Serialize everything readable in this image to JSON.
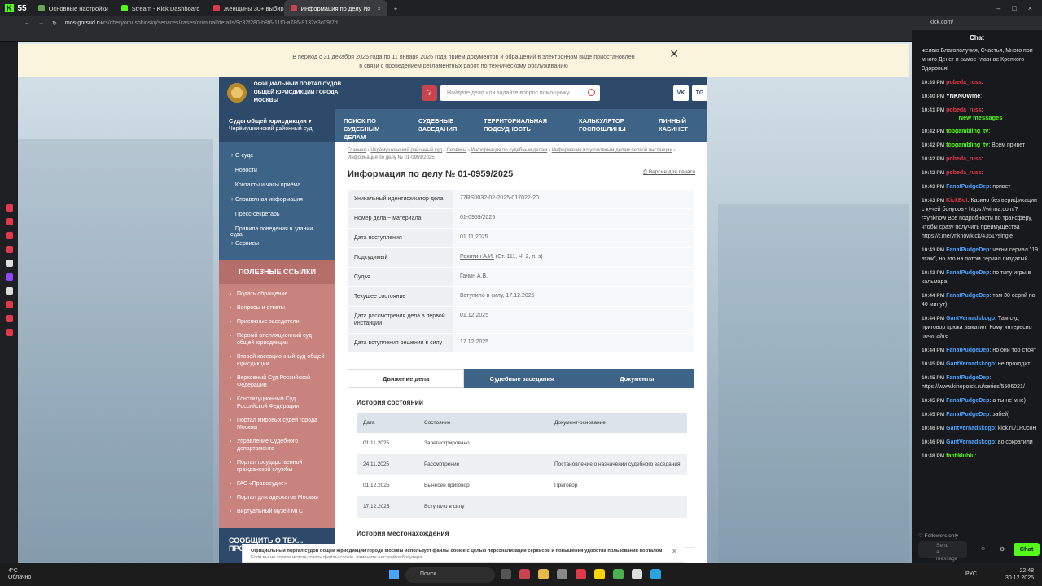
{
  "browser": {
    "kick_badge": "55",
    "tabs": [
      {
        "label": "Основные настройки",
        "color": "#6aa84f"
      },
      {
        "label": "Stream - Kick Dashboard",
        "color": "#53fc18"
      },
      {
        "label": "Женщины 30+ выбирают",
        "color": "#e0394a"
      },
      {
        "label": "Информация по делу №",
        "color": "#c9444c",
        "active": true
      }
    ],
    "url_host": "mos-gorsud.ru",
    "url_path": "/rs/cheryomushkinskij/services/cases/criminal/details/9c32f280-b8f6-11f0-a786-8132e3c09f7d",
    "right_url": "kick.com/"
  },
  "notice": {
    "line1": "В период с 31 декабря 2025 года по 11 января 2026 года приём документов и обращений в электронном виде приостановлен",
    "line2": "в связи с проведением регламентных работ по техническому обслуживанию"
  },
  "site": {
    "portal_title": "ОФИЦИАЛЬНЫЙ ПОРТАЛ СУДОВ ОБЩЕЙ ЮРИСДИКЦИИ ГОРОДА МОСКВЫ",
    "search_placeholder": "Найдите дело или задайте вопрос помощнику",
    "social": [
      "VK",
      "TG"
    ],
    "court_select": {
      "title": "Суды общей юрисдикции",
      "sub": "Черёмушкинский районный суд"
    },
    "nav": [
      "Поиск по судебным делам",
      "Судебные заседания",
      "Территориальная подсудность",
      "Калькулятор госпошлины",
      "Личный кабинет"
    ],
    "left_menu": [
      "О суде",
      "Новости",
      "Контакты и часы приёма",
      "Справочная информация",
      "Пресс-секретарь",
      "Правила поведения в здании суда",
      "Сервисы"
    ],
    "useful_title": "ПОЛЕЗНЫЕ ССЫЛКИ",
    "useful_links": [
      "Подать обращение",
      "Вопросы и ответы",
      "Присяжные заседатели",
      "Первый апелляционный суд общей юрисдикции",
      "Второй кассационный суд общей юрисдикции",
      "Верховный Суд Российской Федерации",
      "Конституционный Суд Российской Федерации",
      "Портал мировых судей города Москвы",
      "Управление Судебного департамента",
      "Портал государственной гражданской службы",
      "ГАС «Правосудие»",
      "Портал для адвокатов Москвы",
      "Виртуальный музей МГС"
    ],
    "report_box": "СООБЩИТЬ О ТЕХ... ПРО..."
  },
  "content": {
    "breadcrumb": [
      "Главная",
      "Черёмушкинский районный суд",
      "Сервисы",
      "Информация по судебным делам",
      "Информация по уголовным делам первой инстанции",
      "Информация по делу № 01-0959/2025"
    ],
    "title": "Информация по делу № 01-0959/2025",
    "print_link": "Версия для печати",
    "info": [
      {
        "k": "Уникальный идентификатор дела",
        "v": "77RS0032-02-2025-017022-20"
      },
      {
        "k": "Номер дела ~ материала",
        "v": "01-0959/2025"
      },
      {
        "k": "Дата поступления",
        "v": "01.11.2025"
      },
      {
        "k": "Подсудимый",
        "v": "Ракитин А.И.",
        "v2": " (Ст. 111, Ч. 2, п. з)"
      },
      {
        "k": "Судья",
        "v": "Ганин А.В."
      },
      {
        "k": "Текущее состояние",
        "v": "Вступило в силу, 17.12.2025"
      },
      {
        "k": "Дата рассмотрения дела в первой инстанции",
        "v": "01.12.2025"
      },
      {
        "k": "Дата вступления решения в силу",
        "v": "17.12.2025"
      }
    ],
    "tabs": [
      "Движение дела",
      "Судебные заседания",
      "Документы"
    ],
    "history_title": "История состояний",
    "history_headers": [
      "Дата",
      "Состояние",
      "Документ-основание"
    ],
    "history_rows": [
      [
        "01.11.2025",
        "Зарегистрировано",
        ""
      ],
      [
        "24.11.2025",
        "Рассмотрение",
        "Постановление о назначении судебного заседания"
      ],
      [
        "01.12.2025",
        "Вынесен приговор",
        "Приговор"
      ],
      [
        "17.12.2025",
        "Вступило в силу",
        ""
      ]
    ],
    "location_title": "История местонахождения"
  },
  "cookie": {
    "line1": "Официальный портал судов общей юрисдикции города Москвы использует файлы cookie с целью персонализации сервисов и повышения удобства пользования порталом.",
    "line2": "Если вы не хотите использовать файлы cookie, измените настройки браузера."
  },
  "chat": {
    "title": "Chat",
    "messages": [
      {
        "t": "",
        "u": "",
        "uc": "#ddd",
        "text": "желаю Благополучия, Счастья, Много при много Денег и самое главное Крепкого Здоровья!"
      },
      {
        "t": "10:39 PM",
        "u": "pobeda_russ",
        "uc": "#e0394a",
        "text": ":"
      },
      {
        "t": "10:40 PM",
        "u": "YNKNOWme",
        "uc": "#fff",
        "text": ":"
      },
      {
        "t": "10:41 PM",
        "u": "pobeda_russ",
        "uc": "#e0394a",
        "text": ":"
      }
    ],
    "new_messages": "New messages",
    "messages2": [
      {
        "t": "10:42 PM",
        "u": "topgambling_tv",
        "uc": "#53fc18",
        "text": ":"
      },
      {
        "t": "10:42 PM",
        "u": "topgambling_tv",
        "uc": "#53fc18",
        "text": ": Всем привет"
      },
      {
        "t": "10:42 PM",
        "u": "pobeda_russ",
        "uc": "#e0394a",
        "text": ":"
      },
      {
        "t": "10:42 PM",
        "u": "pobeda_russ",
        "uc": "#e0394a",
        "text": ":"
      },
      {
        "t": "10:43 PM",
        "u": "FanatPudgeDep",
        "uc": "#4aa3ff",
        "text": ": привет"
      },
      {
        "t": "10:43 PM",
        "u": "KickBot",
        "uc": "#e0394a",
        "text": ": Казино без верификации с кучей бонусов - https://winna.com/?r=ynknow Все подробности по трансферу, чтобы сразу получить преимущества https://t.me/ynknowkick/4351?single"
      },
      {
        "t": "10:43 PM",
        "u": "FanatPudgeDep",
        "uc": "#4aa3ff",
        "text": ": чекни сериал \"19 этаж\", но это на потом сериал пиздатый"
      },
      {
        "t": "10:43 PM",
        "u": "FanatPudgeDep",
        "uc": "#4aa3ff",
        "text": ": по типу игры в кальмара"
      },
      {
        "t": "10:44 PM",
        "u": "FanatPudgeDep",
        "uc": "#4aa3ff",
        "text": ": там 30 серий по 40 минут)"
      },
      {
        "t": "10:44 PM",
        "u": "GantVernadskogo",
        "uc": "#4aa3ff",
        "text": ": Там суд приговор крюка выкатил. Кому интересно почитайте"
      },
      {
        "t": "10:44 PM",
        "u": "FanatPudgeDep",
        "uc": "#4aa3ff",
        "text": ": но они тоо стоят"
      },
      {
        "t": "10:45 PM",
        "u": "GantVernadskogo",
        "uc": "#4aa3ff",
        "text": ": не проходит"
      },
      {
        "t": "10:45 PM",
        "u": "FanatPudgeDep",
        "uc": "#4aa3ff",
        "text": ": https://www.kinopoisk.ru/series/5506021/"
      },
      {
        "t": "10:45 PM",
        "u": "FanatPudgeDep",
        "uc": "#4aa3ff",
        "text": ": а ты не мне)"
      },
      {
        "t": "10:45 PM",
        "u": "FanatPudgeDep",
        "uc": "#4aa3ff",
        "text": ": забей)"
      },
      {
        "t": "10:46 PM",
        "u": "GantVernadskogo",
        "uc": "#4aa3ff",
        "text": ": kick.ru/1R0coH"
      },
      {
        "t": "10:46 PM",
        "u": "GantVernadskogo",
        "uc": "#4aa3ff",
        "text": ": во сократили"
      },
      {
        "t": "10:48 PM",
        "u": "fantikIublu",
        "uc": "#53fc18",
        "text": ":"
      }
    ],
    "followers_only": "Followers only",
    "send_placeholder": "Send a message",
    "chat_button": "Chat"
  },
  "taskbar": {
    "temp": "4°C",
    "weather": "Облачно",
    "search": "Поиск",
    "lang": "РУС",
    "time": "22:48",
    "date": "30.12.2025"
  }
}
